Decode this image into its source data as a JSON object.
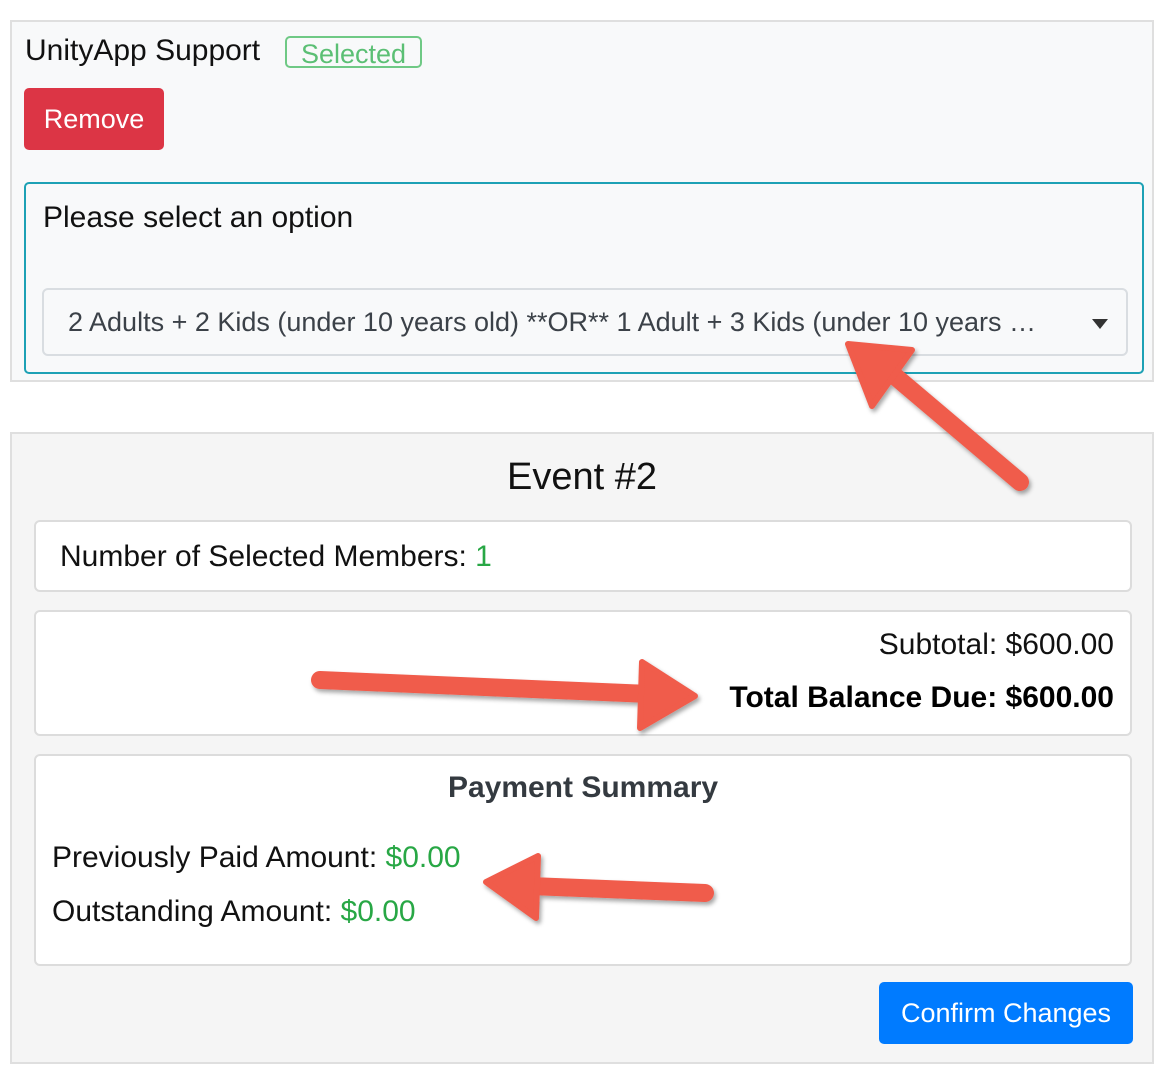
{
  "item": {
    "title": "UnityApp Support",
    "badge": "Selected",
    "remove_label": "Remove"
  },
  "option_box": {
    "label": "Please select an option",
    "selected_value": "2 Adults + 2 Kids (under 10 years old) **OR** 1 Adult + 3 Kids (under 10 years …"
  },
  "event": {
    "title": "Event #2",
    "members_label": "Number of Selected Members: ",
    "members_value": "1",
    "subtotal_label": "Subtotal: ",
    "subtotal_value": "$600.00",
    "total_label": "Total Balance Due: ",
    "total_value": "$600.00"
  },
  "payment_summary": {
    "title": "Payment Summary",
    "paid_label": "Previously Paid Amount: ",
    "paid_value": "$0.00",
    "outstanding_label": "Outstanding Amount: ",
    "outstanding_value": "$0.00"
  },
  "actions": {
    "confirm_label": "Confirm Changes"
  },
  "colors": {
    "danger": "#dc3545",
    "primary": "#007bff",
    "success": "#28a745",
    "badge": "#5bbf74",
    "focus_border": "#1da1b5",
    "annotation_arrow": "#f05b4b"
  },
  "icons": {
    "select_caret": "chevron-down-icon",
    "annotation": "arrow-icon"
  }
}
